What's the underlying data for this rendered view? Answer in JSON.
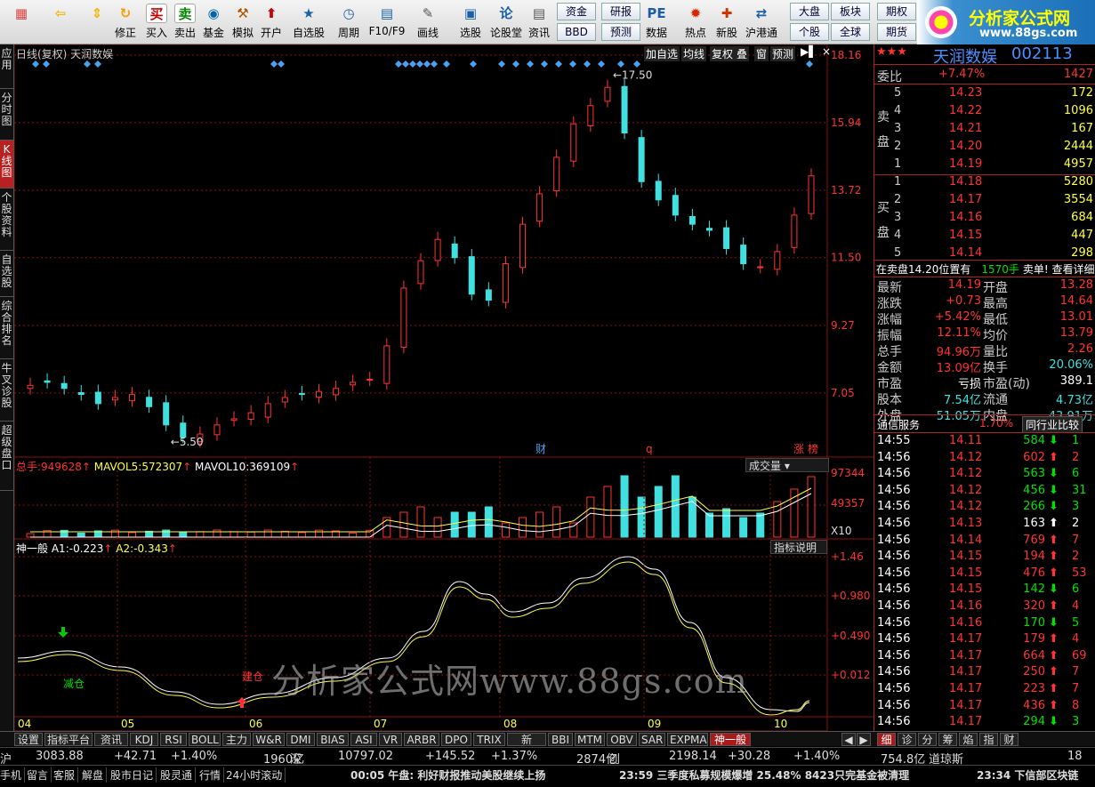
{
  "toolbar": {
    "buttons": [
      {
        "label": "",
        "icon": "windows-icon"
      },
      {
        "label": "",
        "icon": "back-icon"
      },
      {
        "label": "",
        "icon": "up-down-icon"
      },
      {
        "label": "修正",
        "icon": "refresh-icon"
      },
      {
        "label": "买入",
        "icon": "buy-icon",
        "glyph": "买"
      },
      {
        "label": "卖出",
        "icon": "sell-icon",
        "glyph": "卖"
      },
      {
        "label": "基金",
        "icon": "fund-icon"
      },
      {
        "label": "模拟",
        "icon": "hammer-icon"
      },
      {
        "label": "开户",
        "icon": "open-account-icon"
      },
      {
        "label": "自选股",
        "icon": "star-folder-icon"
      },
      {
        "label": "周期",
        "icon": "clock-icon"
      },
      {
        "label": "F10/F9",
        "icon": "f10-icon"
      },
      {
        "label": "画线",
        "icon": "pen-icon"
      },
      {
        "label": "选股",
        "icon": "screen-icon"
      },
      {
        "label": "论股堂",
        "icon": "forum-icon",
        "glyph": "论"
      },
      {
        "label": "资讯",
        "icon": "news-icon"
      },
      {
        "label": "数据",
        "icon": "pe-icon"
      },
      {
        "label": "热点",
        "icon": "hot-icon"
      },
      {
        "label": "新股",
        "icon": "new-stock-icon"
      },
      {
        "label": "沪港通",
        "icon": "sh-hk-icon"
      }
    ],
    "small_buttons": [
      "资金",
      "BBD",
      "研报",
      "预测",
      "大盘",
      "个股",
      "板块",
      "全球",
      "期权",
      "期货"
    ]
  },
  "logo": {
    "title": "分析家公式网",
    "url": "www.88gs.com"
  },
  "left_tabs": [
    "应用",
    "分时图",
    "K线图",
    "个股资料",
    "自选股",
    "综合排名",
    "牛叉诊股",
    "超级盘口"
  ],
  "chart": {
    "title": "日线(复权) 天润数娱",
    "header_buttons": [
      "加自选",
      "均线",
      "复权",
      "叠",
      "窗",
      "预测"
    ],
    "price_axis": [
      "18.16",
      "15.94",
      "13.72",
      "11.50",
      "9.27",
      "7.05"
    ],
    "high_label": "17.50",
    "low_label": "5.50",
    "event_labels": [
      "财",
      "q",
      "涨",
      "榜"
    ],
    "volume_header": {
      "prefix": "总手:",
      "total": "949628",
      "ma5_label": "MAVOL5:",
      "ma5": "572307",
      "ma10_label": "MAVOL10:",
      "ma10": "369109"
    },
    "volume_button": "成交量",
    "volume_axis": [
      "97344",
      "49357",
      "X10"
    ],
    "indicator_header": {
      "name": "神一般",
      "a1_label": "A1:",
      "a1": "-0.223",
      "a2_label": "A2:",
      "a2": "-0.343"
    },
    "indicator_button": "指标说明",
    "indicator_axis": [
      "+1.46",
      "+0.980",
      "+0.490",
      "+0.012"
    ],
    "indicator_labels": {
      "reduce": "减仓",
      "build": "建仓"
    },
    "months": [
      "04",
      "05",
      "06",
      "07",
      "08",
      "09",
      "10"
    ],
    "watermark": "分析家公式网www.88gs.com"
  },
  "chart_data": {
    "type": "candlestick",
    "stock": "天润数娱",
    "approx_closes": [
      7.3,
      7.4,
      7.2,
      7.0,
      6.7,
      6.9,
      7.0,
      6.6,
      6.0,
      5.6,
      5.7,
      6.0,
      6.2,
      6.4,
      6.7,
      6.9,
      7.0,
      7.1,
      7.2,
      7.4,
      7.5,
      8.6,
      10.5,
      11.4,
      12.1,
      11.5,
      10.3,
      10.1,
      11.3,
      12.6,
      13.6,
      14.8,
      15.9,
      16.5,
      17.1,
      15.6,
      14.0,
      13.4,
      12.9,
      12.6,
      12.4,
      11.8,
      11.3,
      11.2,
      11.7,
      12.9,
      14.19
    ],
    "ylim": [
      5.0,
      18.16
    ],
    "volume_ylim": [
      0,
      97344
    ],
    "indicator": {
      "name": "神一般",
      "A1": -0.223,
      "A2": -0.343,
      "ylim": [
        -0.4,
        1.46
      ]
    }
  },
  "stock": {
    "stars": "★★★",
    "name": "天润数娱",
    "code": "002113",
    "weibi_label": "委比",
    "weibi": "+7.47%",
    "weicha": "1427"
  },
  "sell_orders": [
    {
      "lvl": "5",
      "price": "14.23",
      "vol": "172"
    },
    {
      "lvl": "4",
      "price": "14.22",
      "vol": "1096"
    },
    {
      "lvl": "3",
      "price": "14.21",
      "vol": "167"
    },
    {
      "lvl": "2",
      "price": "14.20",
      "vol": "2444"
    },
    {
      "lvl": "1",
      "price": "14.19",
      "vol": "4957"
    }
  ],
  "buy_orders": [
    {
      "lvl": "1",
      "price": "14.18",
      "vol": "5280"
    },
    {
      "lvl": "2",
      "price": "14.17",
      "vol": "3554"
    },
    {
      "lvl": "3",
      "price": "14.16",
      "vol": "684"
    },
    {
      "lvl": "4",
      "price": "14.15",
      "vol": "447"
    },
    {
      "lvl": "5",
      "price": "14.14",
      "vol": "298"
    }
  ],
  "sell_label": "卖盘",
  "buy_label": "买盘",
  "notice": {
    "text": "在卖盘14.20位置有",
    "vol": "1570手",
    "tail": "卖单! 查看详细"
  },
  "stats": [
    {
      "l": "最新",
      "v": "14.19",
      "l2": "开盘",
      "v2": "13.28"
    },
    {
      "l": "涨跌",
      "v": "+0.73",
      "l2": "最高",
      "v2": "14.64"
    },
    {
      "l": "涨幅",
      "v": "+5.42%",
      "l2": "最低",
      "v2": "13.01"
    },
    {
      "l": "振幅",
      "v": "12.11%",
      "l2": "均价",
      "v2": "13.79"
    },
    {
      "l": "总手",
      "v": "94.96万",
      "l2": "量比",
      "v2": "2.26"
    },
    {
      "l": "金额",
      "v": "13.09亿",
      "l2": "换手",
      "v2": "20.06%"
    },
    {
      "l": "市盈",
      "v": "亏损",
      "l2": "市盈(动)",
      "v2": "389.1"
    },
    {
      "l": "股本",
      "v": "7.54亿",
      "l2": "流通",
      "v2": "4.73亿"
    },
    {
      "l": "外盘",
      "v": "51.05万",
      "l2": "内盘",
      "v2": "43.91万"
    }
  ],
  "industry": {
    "name": "通信服务",
    "pct": "1.70%",
    "btn": "同行业比较"
  },
  "ticks": [
    {
      "t": "14:55",
      "p": "14.11",
      "v": "584",
      "d": "down",
      "n": "1"
    },
    {
      "t": "14:56",
      "p": "14.12",
      "v": "602",
      "d": "up",
      "n": "2"
    },
    {
      "t": "14:56",
      "p": "14.12",
      "v": "563",
      "d": "down",
      "n": "6"
    },
    {
      "t": "14:56",
      "p": "14.12",
      "v": "456",
      "d": "down",
      "n": "31"
    },
    {
      "t": "14:56",
      "p": "14.12",
      "v": "266",
      "d": "down",
      "n": "3"
    },
    {
      "t": "14:56",
      "p": "14.13",
      "v": "163",
      "d": "flat",
      "n": "2"
    },
    {
      "t": "14:56",
      "p": "14.14",
      "v": "769",
      "d": "up",
      "n": "7"
    },
    {
      "t": "14:56",
      "p": "14.15",
      "v": "194",
      "d": "up",
      "n": "2"
    },
    {
      "t": "14:56",
      "p": "14.15",
      "v": "476",
      "d": "up",
      "n": "53"
    },
    {
      "t": "14:56",
      "p": "14.15",
      "v": "142",
      "d": "down",
      "n": "6"
    },
    {
      "t": "14:56",
      "p": "14.16",
      "v": "320",
      "d": "up",
      "n": "4"
    },
    {
      "t": "14:56",
      "p": "14.16",
      "v": "170",
      "d": "down",
      "n": "5"
    },
    {
      "t": "14:56",
      "p": "14.17",
      "v": "179",
      "d": "up",
      "n": "4"
    },
    {
      "t": "14:56",
      "p": "14.17",
      "v": "664",
      "d": "up",
      "n": "69"
    },
    {
      "t": "14:56",
      "p": "14.17",
      "v": "250",
      "d": "up",
      "n": "7"
    },
    {
      "t": "14:56",
      "p": "14.17",
      "v": "223",
      "d": "up",
      "n": "7"
    },
    {
      "t": "14:56",
      "p": "14.17",
      "v": "436",
      "d": "up",
      "n": "8"
    },
    {
      "t": "14:56",
      "p": "14.17",
      "v": "294",
      "d": "down",
      "n": "3"
    }
  ],
  "right_tabs": [
    "细",
    "诊",
    "分",
    "筹",
    "焰",
    "指",
    "财"
  ],
  "bottom_tabs": [
    "设置",
    "指标平台",
    "资讯",
    "KDJ",
    "RSI",
    "BOLL",
    "主力",
    "W&R",
    "DMI",
    "BIAS",
    "ASI",
    "VR",
    "ARBR",
    "DPO",
    "TRIX",
    "新DMA",
    "BBI",
    "MTM",
    "OBV",
    "SAR",
    "EXPMA",
    "神一般"
  ],
  "index_bar": [
    {
      "t": "沪",
      "c": "wht"
    },
    {
      "t": "3083.88",
      "c": "red"
    },
    {
      "t": "+42.71",
      "c": "red"
    },
    {
      "t": "+1.40%",
      "c": "red"
    },
    {
      "t": "1960亿",
      "c": "cyan"
    },
    {
      "t": "深",
      "c": "wht"
    },
    {
      "t": "10797.02",
      "c": "red"
    },
    {
      "t": "+145.52",
      "c": "red"
    },
    {
      "t": "+1.37%",
      "c": "red"
    },
    {
      "t": "2874亿",
      "c": "cyan"
    },
    {
      "t": "创",
      "c": "wht"
    },
    {
      "t": "2198.14",
      "c": "red"
    },
    {
      "t": "+30.28",
      "c": "red"
    },
    {
      "t": "+1.40%",
      "c": "red"
    },
    {
      "t": "754.8亿",
      "c": "cyan"
    },
    {
      "t": "道琼斯",
      "c": "wht"
    },
    {
      "t": "18",
      "c": "wht"
    }
  ],
  "status_bar": {
    "items": [
      "手机",
      "留言",
      "客服",
      "解盘",
      "股市日记",
      "股灵通",
      "行情",
      "24小时滚动"
    ],
    "news1": "00:05 午盘: 利好财报推动美股继续上扬",
    "news2": "23:59 三季度私募规模爆增 25.48% 8423只完基金被清理",
    "news3": "23:34 下信部区块链"
  },
  "colors": {
    "up": "#ff3333",
    "down": "#40e0e0",
    "ma": "#ffff40",
    "grid": "#8a1010"
  }
}
